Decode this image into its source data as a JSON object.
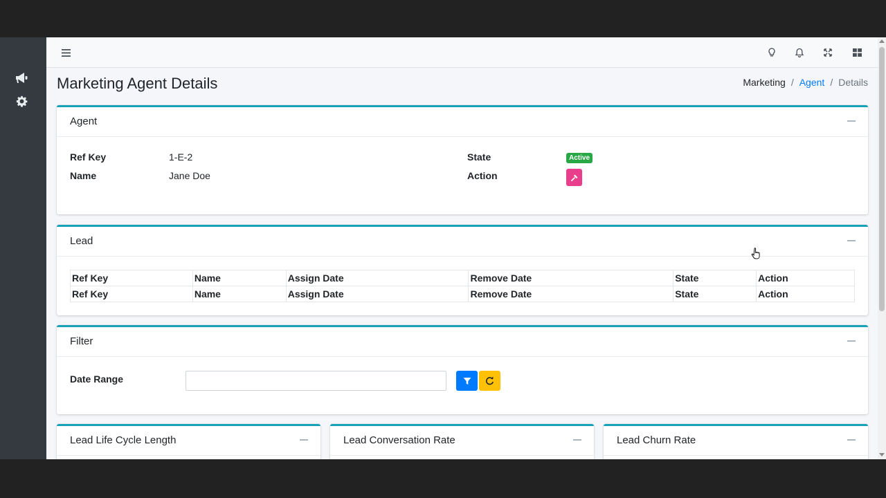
{
  "sidebar": {
    "items": [
      {
        "icon": "megaphone-icon"
      },
      {
        "icon": "gear-icon"
      }
    ]
  },
  "navbar": {
    "menu_icon": "hamburger-menu-icon",
    "right_icons": [
      "lightbulb-icon",
      "bell-icon",
      "fullscreen-icon",
      "grid-icon"
    ]
  },
  "page": {
    "title": "Marketing Agent Details"
  },
  "breadcrumb": {
    "items": [
      "Marketing",
      "Agent",
      "Details"
    ],
    "separator": "/"
  },
  "agent_card": {
    "title": "Agent",
    "ref_key_label": "Ref Key",
    "ref_key_value": "1-E-2",
    "name_label": "Name",
    "name_value": "Jane Doe",
    "state_label": "State",
    "state_value": "Active",
    "action_label": "Action"
  },
  "lead_card": {
    "title": "Lead",
    "columns": [
      "Ref Key",
      "Name",
      "Assign Date",
      "Remove Date",
      "State",
      "Action"
    ],
    "footer_columns": [
      "Ref Key",
      "Name",
      "Assign Date",
      "Remove Date",
      "State",
      "Action"
    ]
  },
  "filter_card": {
    "title": "Filter",
    "date_range_label": "Date Range",
    "date_range_value": "",
    "date_range_placeholder": ""
  },
  "metric_cards": [
    {
      "title": "Lead Life Cycle Length"
    },
    {
      "title": "Lead Conversation Rate"
    },
    {
      "title": "Lead Churn Rate"
    }
  ],
  "colors": {
    "card_accent": "#17a2b8",
    "badge_active": "#28a745",
    "action_button": "#e83e8c",
    "filter_button": "#007bff",
    "reset_button": "#ffc107",
    "link": "#007bff",
    "sidebar": "#343a40"
  }
}
